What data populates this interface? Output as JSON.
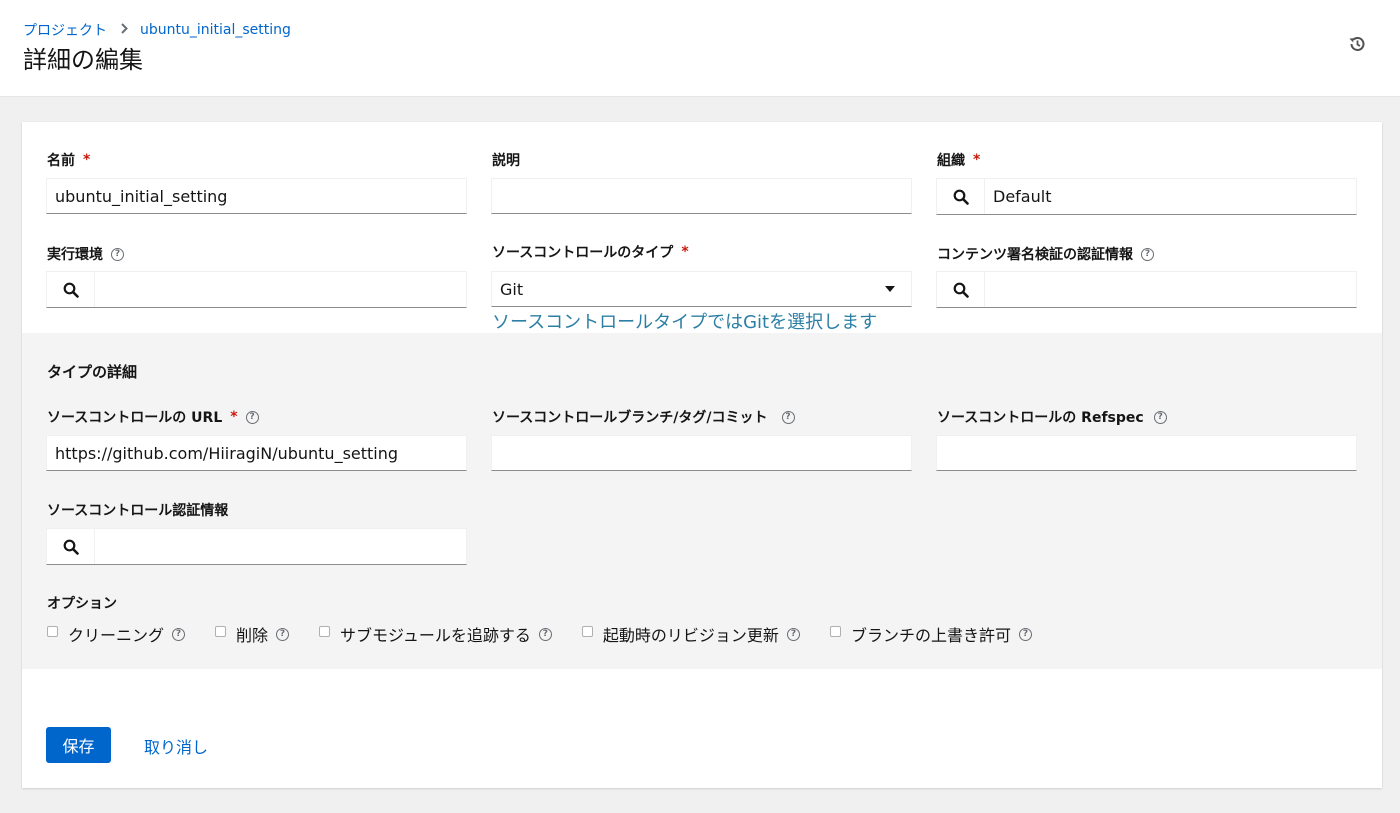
{
  "breadcrumb": {
    "parent": "プロジェクト",
    "current": "ubuntu_initial_setting"
  },
  "page_title": "詳細の編集",
  "fields": {
    "name": {
      "label": "名前",
      "value": "ubuntu_initial_setting"
    },
    "description": {
      "label": "説明",
      "value": ""
    },
    "organization": {
      "label": "組織",
      "value": "Default"
    },
    "execution_env": {
      "label": "実行環境",
      "value": ""
    },
    "scm_type": {
      "label": "ソースコントロールのタイプ",
      "value": "Git",
      "helper": "ソースコントロールタイプではGitを選択します"
    },
    "signature_credential": {
      "label": "コンテンツ署名検証の認証情報",
      "value": ""
    }
  },
  "type_details": {
    "title": "タイプの詳細",
    "scm_url": {
      "label": "ソースコントロールの URL",
      "value": "https://github.com/HiiragiN/ubuntu_setting"
    },
    "scm_branch": {
      "label": "ソースコントロールブランチ/タグ/コミット",
      "value": ""
    },
    "scm_refspec": {
      "label": "ソースコントロールの Refspec",
      "value": ""
    },
    "scm_credential": {
      "label": "ソースコントロール認証情報",
      "value": ""
    },
    "options_title": "オプション",
    "options": [
      "クリーニング",
      "削除",
      "サブモジュールを追跡する",
      "起動時のリビジョン更新",
      "ブランチの上書き許可"
    ]
  },
  "actions": {
    "save": "保存",
    "cancel": "取り消し"
  },
  "required_mark": "*",
  "help_mark": "?",
  "colors": {
    "primary": "#0066cc",
    "required": "#c9190b",
    "helper_text": "#2b7fa4"
  }
}
